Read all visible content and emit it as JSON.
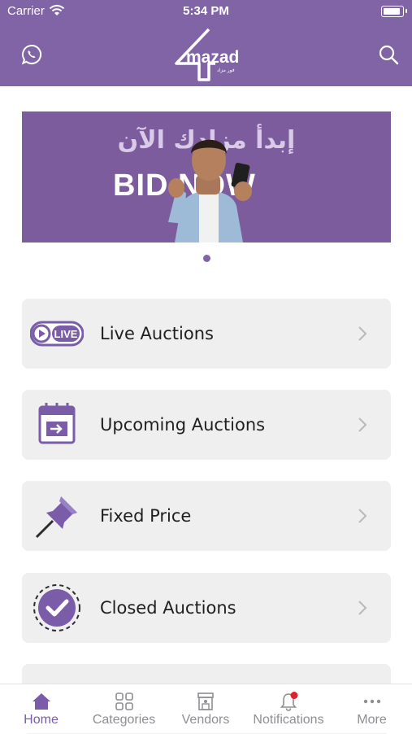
{
  "status_bar": {
    "carrier": "Carrier",
    "time": "5:34 PM"
  },
  "header": {
    "logo_text": "mazad",
    "logo_subtext": "فور مزاد"
  },
  "banner": {
    "arabic_text": "إبدأ مزادك الآن",
    "english_text": "BID NOW",
    "active_slide": 1,
    "slide_count": 1
  },
  "menu": [
    {
      "label": "Live Auctions",
      "icon": "live-icon",
      "badge": "LIVE"
    },
    {
      "label": "Upcoming Auctions",
      "icon": "calendar-icon"
    },
    {
      "label": "Fixed Price",
      "icon": "pin-icon"
    },
    {
      "label": "Closed Auctions",
      "icon": "check-badge-icon"
    }
  ],
  "tabs": [
    {
      "label": "Home",
      "icon": "home-icon",
      "active": true
    },
    {
      "label": "Categories",
      "icon": "grid-icon"
    },
    {
      "label": "Vendors",
      "icon": "store-icon"
    },
    {
      "label": "Notifications",
      "icon": "bell-icon",
      "badge": true
    },
    {
      "label": "More",
      "icon": "more-icon"
    }
  ],
  "colors": {
    "brand": "#8064a6",
    "card": "#efeff0",
    "active_tab": "#7a5ca8",
    "notification_dot": "#e0212b"
  }
}
